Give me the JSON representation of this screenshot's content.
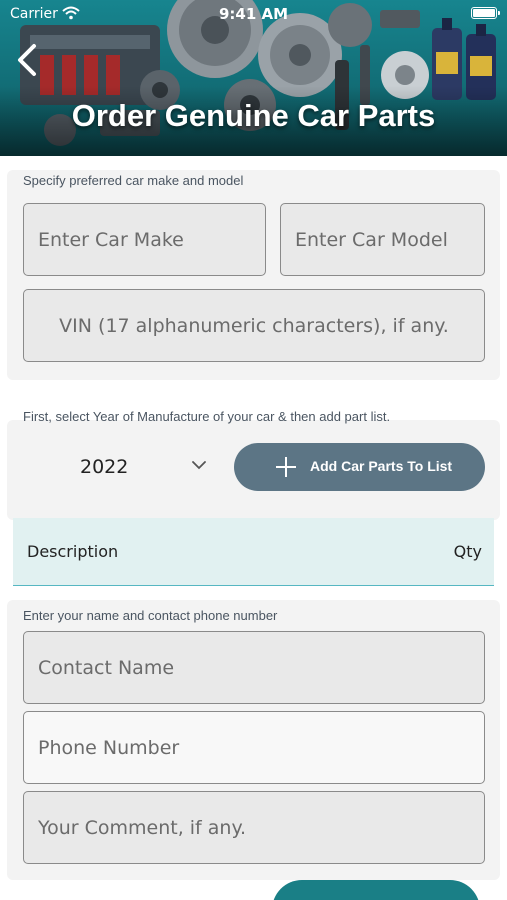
{
  "status_bar": {
    "carrier": "Carrier",
    "time": "9:41 AM"
  },
  "header": {
    "title": "Order Genuine Car Parts",
    "back_icon": "chevron-left-icon"
  },
  "vehicle_section": {
    "label": "Specify preferred car make and model",
    "make_placeholder": "Enter Car Make",
    "model_placeholder": "Enter Car Model",
    "vin_placeholder": "VIN (17 alphanumeric characters), if any."
  },
  "parts_section": {
    "label": "First, select Year of Manufacture of your car & then add part list.",
    "year_value": "2022",
    "add_button_label": "Add Car Parts To List",
    "table_headers": {
      "description": "Description",
      "qty": "Qty"
    }
  },
  "contact_section": {
    "label": "Enter your name and contact phone number",
    "name_placeholder": "Contact Name",
    "phone_placeholder": "Phone Number",
    "comment_placeholder": "Your Comment, if any."
  },
  "colors": {
    "header_teal": "#17858f",
    "button_slate": "#5c7585",
    "table_header_bg": "#e1f1f1",
    "submit_teal": "#1a7f86"
  }
}
